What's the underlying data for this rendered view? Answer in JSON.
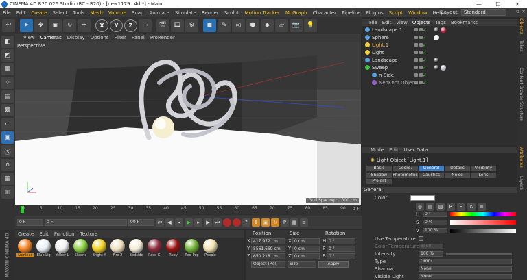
{
  "window": {
    "title": "CINEMA 4D R20.026 Studio (RC - R20) - [new1179.c4d *] - Main",
    "min": "—",
    "max": "☐",
    "close": "✕"
  },
  "menu": [
    "File",
    "Edit",
    "Create",
    "Select",
    "Tools",
    "Mesh",
    "Volume",
    "Snap",
    "Animate",
    "Simulate",
    "Render",
    "Sculpt",
    "Motion Tracker",
    "MoGraph",
    "Character",
    "Pipeline",
    "Plugins",
    "Script",
    "Window",
    "Help"
  ],
  "menu_highlight": [
    "Create",
    "Mesh",
    "Volume",
    "Motion Tracker",
    "MoGraph",
    "Script",
    "Window"
  ],
  "layout": {
    "label": "Layout:",
    "value": "Standard"
  },
  "toolbar": [
    "undo-icon",
    "select-icon",
    "move-icon",
    "scale-icon",
    "rotate-icon",
    "live-selection-icon",
    "x-axis",
    "y-axis",
    "z-axis",
    "coordinate-icon",
    "render-region-icon",
    "render-view-icon",
    "render-settings-icon",
    "cube-icon",
    "pen-icon",
    "subdivision-icon",
    "array-icon",
    "deformer-icon",
    "floor-icon",
    "camera-icon",
    "light-icon"
  ],
  "axes": {
    "x": "X",
    "y": "Y",
    "z": "Z"
  },
  "viewport": {
    "menu": [
      "View",
      "Cameras",
      "Display",
      "Options",
      "Filter",
      "Panel",
      "ProRender"
    ],
    "active": "Cameras",
    "label": "Perspective",
    "grid_spacing": "Grid Spacing : 1000 cm"
  },
  "timeline": {
    "ticks": [
      "0",
      "5",
      "10",
      "15",
      "20",
      "25",
      "30",
      "35",
      "40",
      "45",
      "50",
      "55",
      "60",
      "65",
      "70",
      "75",
      "80",
      "85",
      "90"
    ],
    "end": "0 F"
  },
  "transport": {
    "current": "0 F",
    "start": "0 F",
    "end_min": "90 F",
    "end_max": "90 F"
  },
  "material_menu": [
    "Create",
    "Edit",
    "Function",
    "Texture"
  ],
  "maxon": "MAXON CINEMA 4D",
  "materials": [
    {
      "name": "Luminar",
      "color": "#f08020",
      "selected": true
    },
    {
      "name": "Blue Lig",
      "color": "#e8eef4",
      "selected": false
    },
    {
      "name": "Yellow L",
      "color": "#f0f0f0",
      "selected": false
    },
    {
      "name": "Shrene",
      "color": "#8ad040",
      "selected": false
    },
    {
      "name": "Bright Y",
      "color": "#f0d020",
      "selected": false
    },
    {
      "name": "Fire 2",
      "color": "#f0e0c0",
      "selected": false
    },
    {
      "name": "Bedside",
      "color": "#f4ecd8",
      "selected": false
    },
    {
      "name": "Rose Gl",
      "color": "#8a2a3a",
      "selected": false
    },
    {
      "name": "Ruby",
      "color": "#9a1010",
      "selected": false
    },
    {
      "name": "Red Pep",
      "color": "#70b030",
      "selected": false
    },
    {
      "name": "Poppie",
      "color": "#f0e0b0",
      "selected": false
    }
  ],
  "coords": {
    "headers": [
      "Position",
      "Size",
      "Rotation"
    ],
    "rows": [
      {
        "axis": "X",
        "pos": "417.972 cm",
        "size": "0 cm",
        "rlabel": "H",
        "rot": "0 °"
      },
      {
        "axis": "Y",
        "pos": "5561.669 cm",
        "size": "0 cm",
        "rlabel": "P",
        "rot": "0 °"
      },
      {
        "axis": "Z",
        "pos": "650.218 cm",
        "size": "0 cm",
        "rlabel": "B",
        "rot": "0 °"
      }
    ],
    "mode": "Object (Rel)",
    "size_mode": "Size",
    "apply": "Apply"
  },
  "om_tabs": [
    "File",
    "Edit",
    "View",
    "Objects",
    "Tags",
    "Bookmarks"
  ],
  "om_active": "Objects",
  "objects": [
    {
      "name": "Landscape.1",
      "icon": "#5aa0e0",
      "style": "normal",
      "indent": 0,
      "tags": [
        "#222222",
        "#c02040"
      ]
    },
    {
      "name": "Sphere",
      "icon": "#5aa0e0",
      "style": "normal",
      "indent": 0,
      "tags": [
        "#f0f0f0"
      ]
    },
    {
      "name": "Light.1",
      "icon": "#f0d040",
      "style": "orange",
      "indent": 0,
      "tags": []
    },
    {
      "name": "Light",
      "icon": "#f0d040",
      "style": "normal",
      "indent": 0,
      "tags": []
    },
    {
      "name": "Landscape",
      "icon": "#5aa0e0",
      "style": "normal",
      "indent": 0,
      "tags": [
        "#222222"
      ]
    },
    {
      "name": "Sweep",
      "icon": "#40c040",
      "style": "normal",
      "indent": 0,
      "tags": [
        "#222222",
        "#b0b0c0"
      ]
    },
    {
      "name": "n-Side",
      "icon": "#5aa0e0",
      "style": "normal",
      "indent": 1,
      "tags": []
    },
    {
      "name": "NeoKnot Object",
      "icon": "#9060c0",
      "style": "dim",
      "indent": 1,
      "tags": []
    }
  ],
  "sidetabs": [
    "Objects",
    "Takes",
    "Content Browser",
    "Structure",
    "Attributes",
    "Layers"
  ],
  "sidetab_active": [
    "Objects",
    "Attributes"
  ],
  "am_menu": [
    "Mode",
    "Edit",
    "User Data"
  ],
  "am_title": "Light Object [Light.1]",
  "am_tabs": [
    "Basic",
    "Coord.",
    "General",
    "Details",
    "Visibility",
    "Shadow",
    "Photometric",
    "Caustics",
    "Noise",
    "Lens",
    "Project"
  ],
  "am_active_tab": "General",
  "am_section": "General",
  "am_fields": {
    "color_label": "Color",
    "h_label": "H",
    "h_val": "0 °",
    "s_label": "S",
    "s_val": "0 %",
    "v_label": "V",
    "v_val": "100 %",
    "use_temp": "Use Temperature",
    "color_temp": "Color Temperature",
    "color_temp_val": "6500",
    "intensity": "Intensity",
    "intensity_val": "100 %",
    "type": "Type",
    "type_val": "Omni",
    "shadow": "Shadow",
    "shadow_val": "None",
    "visible_light": "Visible Light",
    "visible_light_val": "None"
  },
  "colors": {
    "accent": "#2a6fb0",
    "highlight": "#f0c020",
    "active_tab": "#3f7bc1"
  }
}
